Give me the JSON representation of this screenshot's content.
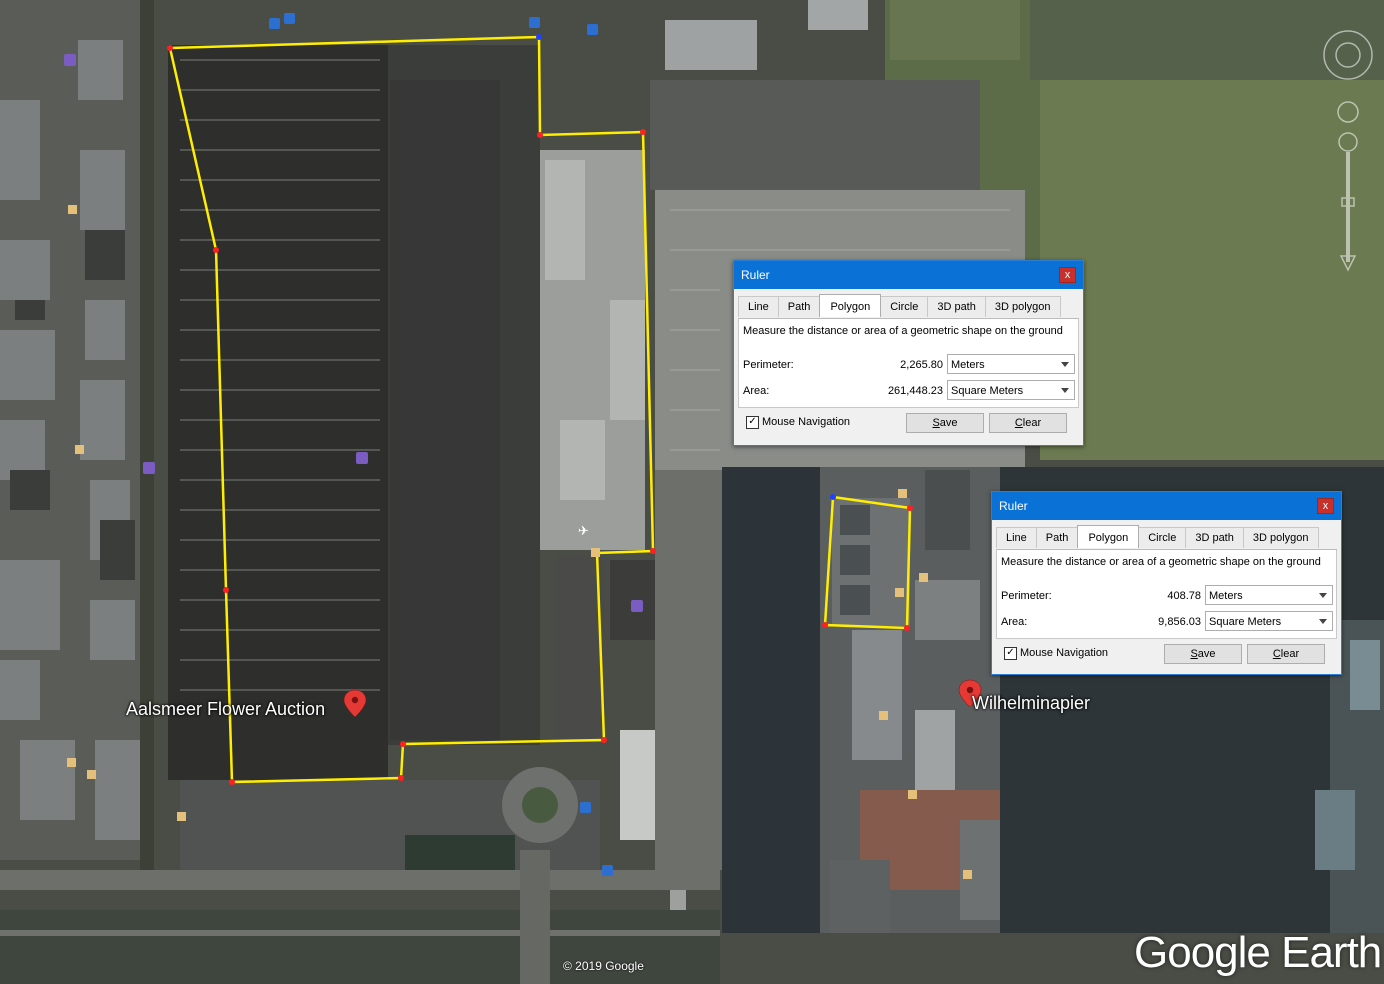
{
  "map": {
    "place_main": "Aalsmeer Flower Auction",
    "place_inset": "Wilhelminapier",
    "copyright": "© 2019 Google",
    "brand": "Google Earth"
  },
  "dialogs": [
    {
      "title": "Ruler",
      "close": "x",
      "tabs": [
        "Line",
        "Path",
        "Polygon",
        "Circle",
        "3D path",
        "3D polygon"
      ],
      "active_tab": "Polygon",
      "description": "Measure the distance or area of a geometric shape on the ground",
      "perimeter_label": "Perimeter:",
      "perimeter_value": "2,265.80",
      "perimeter_unit": "Meters",
      "area_label": "Area:",
      "area_value": "261,448.23",
      "area_unit": "Square Meters",
      "mouse_nav_label": "Mouse Navigation",
      "mouse_nav_checked": "✓",
      "save_label": "Save",
      "clear_label": "Clear"
    },
    {
      "title": "Ruler",
      "close": "x",
      "tabs": [
        "Line",
        "Path",
        "Polygon",
        "Circle",
        "3D path",
        "3D polygon"
      ],
      "active_tab": "Polygon",
      "description": "Measure the distance or area of a geometric shape on the ground",
      "perimeter_label": "Perimeter:",
      "perimeter_value": "408.78",
      "perimeter_unit": "Meters",
      "area_label": "Area:",
      "area_value": "9,856.03",
      "area_unit": "Square Meters",
      "mouse_nav_label": "Mouse Navigation",
      "mouse_nav_checked": "✓",
      "save_label": "Save",
      "clear_label": "Clear"
    }
  ],
  "colors": {
    "polygon_line": "#ffee00",
    "vertex": "#ff2020",
    "titlebar": "#0a72d6",
    "close_button": "#c9302c"
  },
  "icons": [
    "navigation-compass-icon",
    "zoom-slider-icon",
    "placemark-pin-icon",
    "poi-shop-icon",
    "poi-bus-icon",
    "poi-airport-icon",
    "poi-restaurant-icon"
  ]
}
